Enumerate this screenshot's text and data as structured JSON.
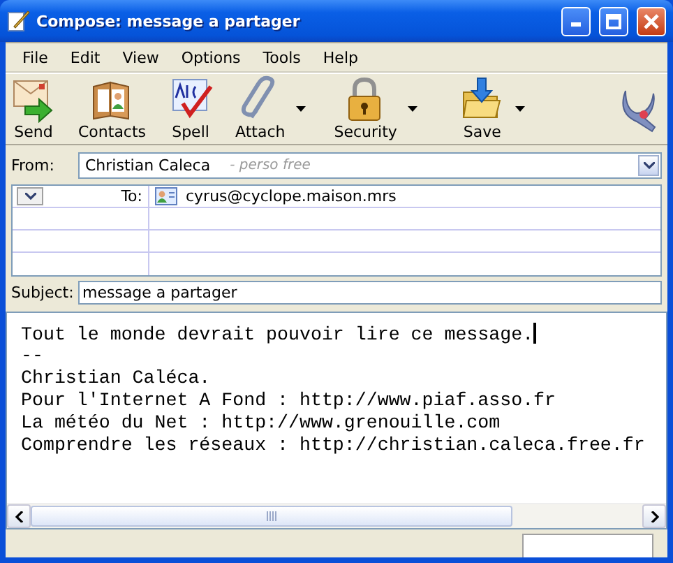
{
  "window": {
    "title": "Compose: message a partager"
  },
  "menu": [
    "File",
    "Edit",
    "View",
    "Options",
    "Tools",
    "Help"
  ],
  "toolbar": [
    {
      "label": "Send",
      "kind": "send",
      "has_menu": false
    },
    {
      "label": "Contacts",
      "kind": "contacts",
      "has_menu": false
    },
    {
      "label": "Spell",
      "kind": "spell",
      "has_menu": false
    },
    {
      "label": "Attach",
      "kind": "attach",
      "has_menu": true
    },
    {
      "label": "Security",
      "kind": "security",
      "has_menu": true
    },
    {
      "label": "Save",
      "kind": "save",
      "has_menu": true
    }
  ],
  "from": {
    "label": "From:",
    "name": "Christian Caleca",
    "account": "- perso free"
  },
  "recipients": [
    {
      "type": "To:",
      "address": "cyrus@cyclope.maison.mrs"
    }
  ],
  "subject": {
    "label": "Subject:",
    "value": "message a partager"
  },
  "body": {
    "lines": [
      "Tout le monde devrait pouvoir lire ce message.",
      "--",
      "Christian Caléca.",
      "Pour l'Internet A Fond : http://www.piaf.asso.fr",
      "La météo du Net : http://www.grenouille.com",
      "Comprendre les réseaux : http://christian.caleca.free.fr"
    ]
  }
}
